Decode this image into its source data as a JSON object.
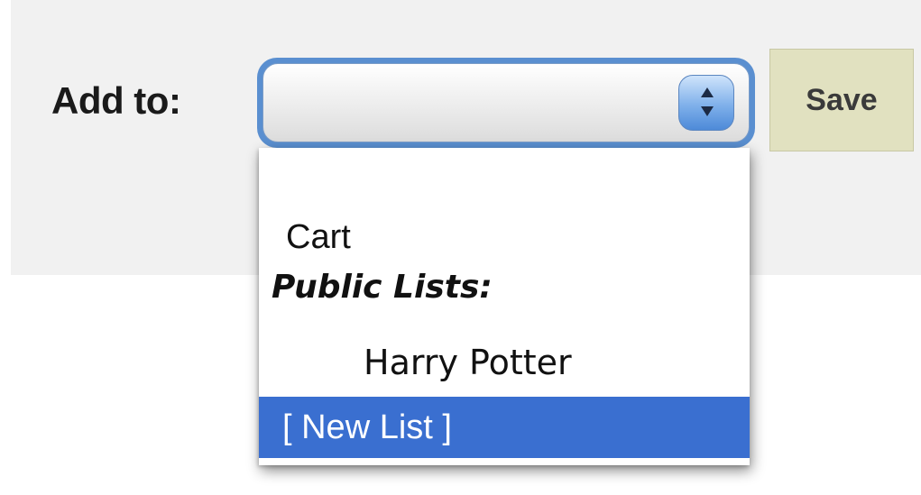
{
  "form": {
    "label": "Add to:",
    "select_value": "",
    "save_label": "Save"
  },
  "dropdown": {
    "options": [
      {
        "label": "",
        "kind": "blank"
      },
      {
        "label": "Cart",
        "kind": "option"
      },
      {
        "label": "Public Lists:",
        "kind": "group"
      },
      {
        "label": "Harry Potter",
        "kind": "option"
      },
      {
        "label": "[ New List ]",
        "kind": "option",
        "selected": true
      }
    ]
  },
  "colors": {
    "accent": "#3a6fd0",
    "focus_ring": "#5a8fd0",
    "save_bg": "#e1e1c0",
    "band_bg": "#f1f1f1"
  },
  "icons": {
    "stepper": "up-down-arrows-icon"
  }
}
